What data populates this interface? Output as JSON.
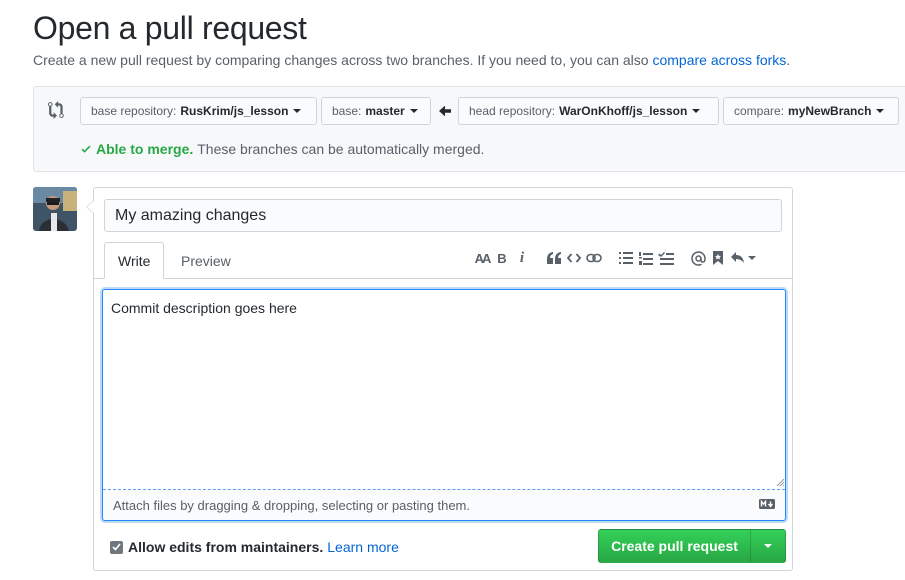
{
  "page": {
    "title": "Open a pull request",
    "subtitle_prefix": "Create a new pull request by comparing changes across two branches. If you need to, you can also",
    "subtitle_link": "compare across forks",
    "subtitle_suffix": "."
  },
  "range": {
    "base_repo_label": "base repository:",
    "base_repo_value": "RusKrim/js_lesson",
    "base_label": "base:",
    "base_value": "master",
    "head_repo_label": "head repository:",
    "head_repo_value": "WarOnKhoff/js_lesson",
    "compare_label": "compare:",
    "compare_value": "myNewBranch",
    "merge_ok": "Able to merge.",
    "merge_msg": "These branches can be automatically merged."
  },
  "form": {
    "title_value": "My amazing changes",
    "tabs": [
      {
        "label": "Write"
      },
      {
        "label": "Preview"
      }
    ],
    "toolbar": {
      "header": "AA",
      "bold": "B",
      "italic": "i",
      "icons": [
        "text-size-icon",
        "bold-icon",
        "italic-icon",
        "quote-icon",
        "code-icon",
        "link-icon",
        "unordered-list-icon",
        "ordered-list-icon",
        "task-list-icon",
        "mention-icon",
        "reference-icon",
        "reply-icon"
      ]
    },
    "body_value": "Commit description goes here",
    "drop_hint": "Attach files by dragging & dropping, selecting or pasting them.",
    "allow_label": "Allow edits from maintainers.",
    "learn_more": "Learn more",
    "submit_label": "Create pull request"
  },
  "colors": {
    "link": "#0366d6",
    "success": "#28a745",
    "button_top": "#34d058",
    "button_bottom": "#28a745"
  }
}
